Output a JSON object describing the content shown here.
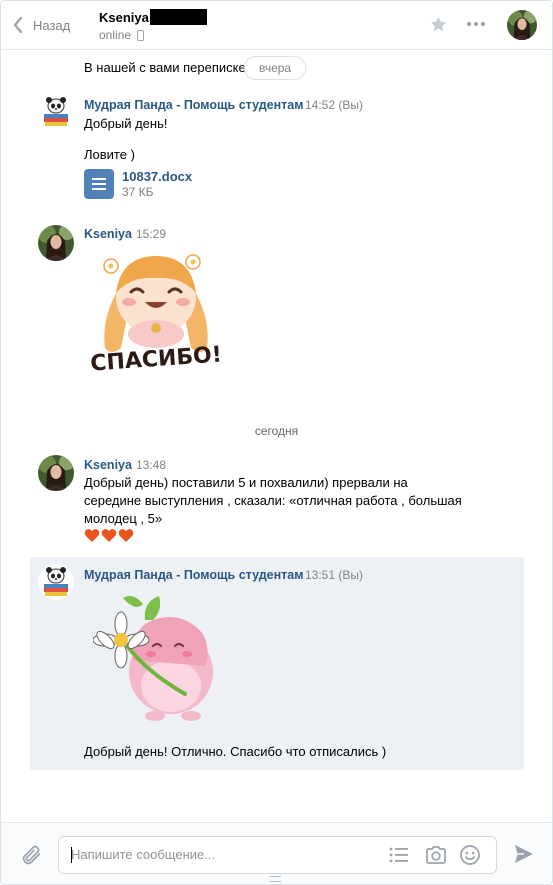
{
  "header": {
    "back_label": "Назад",
    "peer_name": "Kseniya",
    "peer_status": "online"
  },
  "messages_area": {
    "previous_text": "В нашей с вами переписке",
    "date_pill": "вчера",
    "today_separator": "сегодня"
  },
  "messages": [
    {
      "author": "Мудрая Панда - Помощь студентам",
      "time": "14:52 (Вы)",
      "lines": [
        "Добрый день!",
        "Ловите )"
      ],
      "attachment": {
        "name": "10837.docx",
        "size": "37 КБ"
      }
    },
    {
      "author": "Kseniya",
      "time": "15:29",
      "sticker": {
        "caption": "СПАСИБО!"
      }
    },
    {
      "author": "Kseniya",
      "time": "13:48",
      "lines": [
        "Добрый день) поставили 5 и похвалили) прервали на",
        "середине выступления , сказали: «отличная работа , большая",
        "молодец , 5»"
      ],
      "emoji": [
        "❤️",
        "❤️",
        "❤️"
      ]
    },
    {
      "author": "Мудрая Панда - Помощь студентам",
      "time": "13:51 (Вы)",
      "lines": [
        "Добрый день! Отлично. Спасибо что отписались )"
      ],
      "selected": true
    }
  ],
  "composer": {
    "placeholder": "Напишите сообщение..."
  },
  "icons": {
    "back": "chevron-left-icon",
    "favorite": "star-icon",
    "more": "more-dots-icon",
    "attach": "paperclip-icon",
    "templates": "list-icon",
    "camera": "camera-icon",
    "emoji": "smile-icon",
    "send": "send-icon"
  },
  "colors": {
    "link": "#2a5885",
    "accent": "#5181b8",
    "muted": "#828282",
    "selected_bg": "#edf0f5"
  }
}
